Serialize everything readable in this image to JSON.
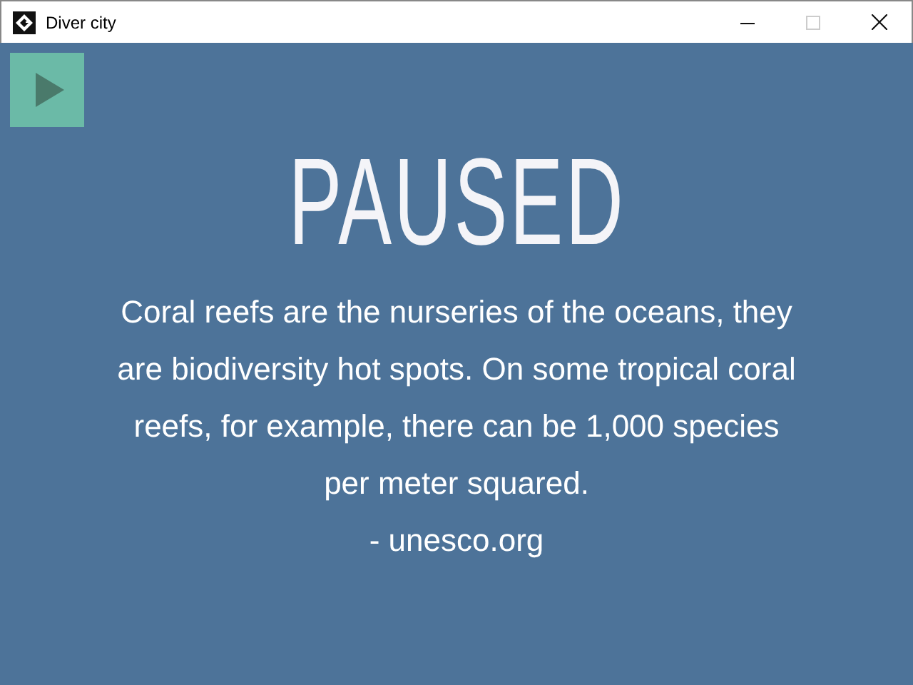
{
  "window": {
    "title": "Diver city",
    "maximize_disabled": true
  },
  "play_button": {
    "kind": "play"
  },
  "heading": "PAUSED",
  "quote": "Coral reefs are the nurseries of the oceans, they are biodiversity hot spots. On some tropical coral reefs, for example, there can be 1,000 species per meter squared.",
  "source": "- unesco.org"
}
